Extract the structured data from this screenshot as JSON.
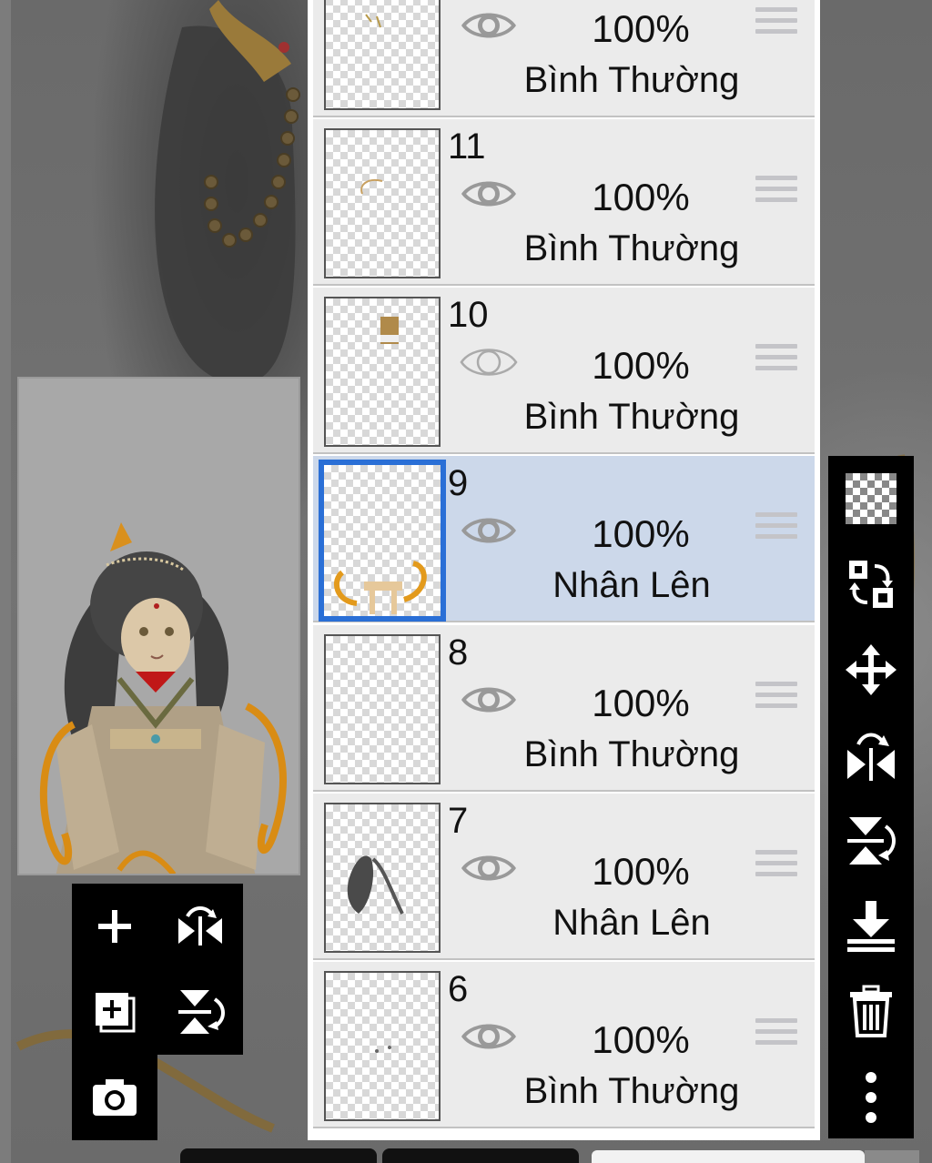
{
  "layers": [
    {
      "number": "",
      "opacity": "100%",
      "blend": "Bình Thường",
      "visible": true
    },
    {
      "number": "11",
      "opacity": "100%",
      "blend": "Bình Thường",
      "visible": true
    },
    {
      "number": "10",
      "opacity": "100%",
      "blend": "Bình Thường",
      "visible": false
    },
    {
      "number": "9",
      "opacity": "100%",
      "blend": "Nhân Lên",
      "visible": true,
      "selected": true
    },
    {
      "number": "8",
      "opacity": "100%",
      "blend": "Bình Thường",
      "visible": true
    },
    {
      "number": "7",
      "opacity": "100%",
      "blend": "Nhân Lên",
      "visible": true
    },
    {
      "number": "6",
      "opacity": "100%",
      "blend": "Bình Thường",
      "visible": true
    }
  ],
  "left_tools": [
    "add-layer-icon",
    "flip-horizontal-icon",
    "add-copy-layer-icon",
    "flip-vertical-icon",
    "camera-icon"
  ],
  "right_tools": [
    "transparency-icon",
    "swap-layers-icon",
    "move-icon",
    "flip-horizontal-icon",
    "flip-vertical-icon",
    "merge-down-icon",
    "trash-icon",
    "more-icon"
  ],
  "colors": {
    "selection": "#2a6fd6",
    "selected_row": "#ccd8ea",
    "row": "#ebebeb",
    "toolbar": "#000000"
  }
}
